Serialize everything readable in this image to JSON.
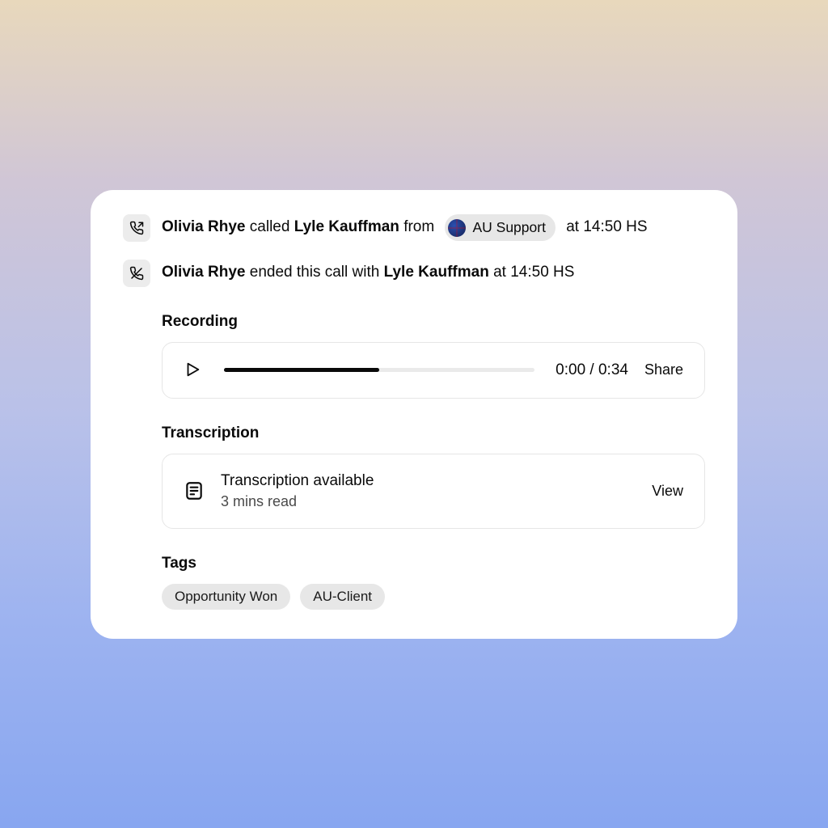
{
  "events": [
    {
      "actor": "Olivia Rhye",
      "verb_before_callee": " called ",
      "callee": "Lyle Kauffman",
      "after_callee": " from ",
      "chip_label": "AU Support",
      "after_chip": " at 14:50 HS"
    },
    {
      "actor": "Olivia Rhye",
      "verb_before_callee": " ended this call with ",
      "callee": "Lyle Kauffman",
      "after_callee": " at 14:50 HS"
    }
  ],
  "recording": {
    "section_title": "Recording",
    "time_label": "0:00 / 0:34",
    "share_label": "Share",
    "progress_percent": 50
  },
  "transcription": {
    "section_title": "Transcription",
    "title": "Transcription available",
    "subtitle": "3 mins read",
    "view_label": "View"
  },
  "tags": {
    "section_title": "Tags",
    "items": [
      "Opportunity Won",
      "AU-Client"
    ]
  }
}
